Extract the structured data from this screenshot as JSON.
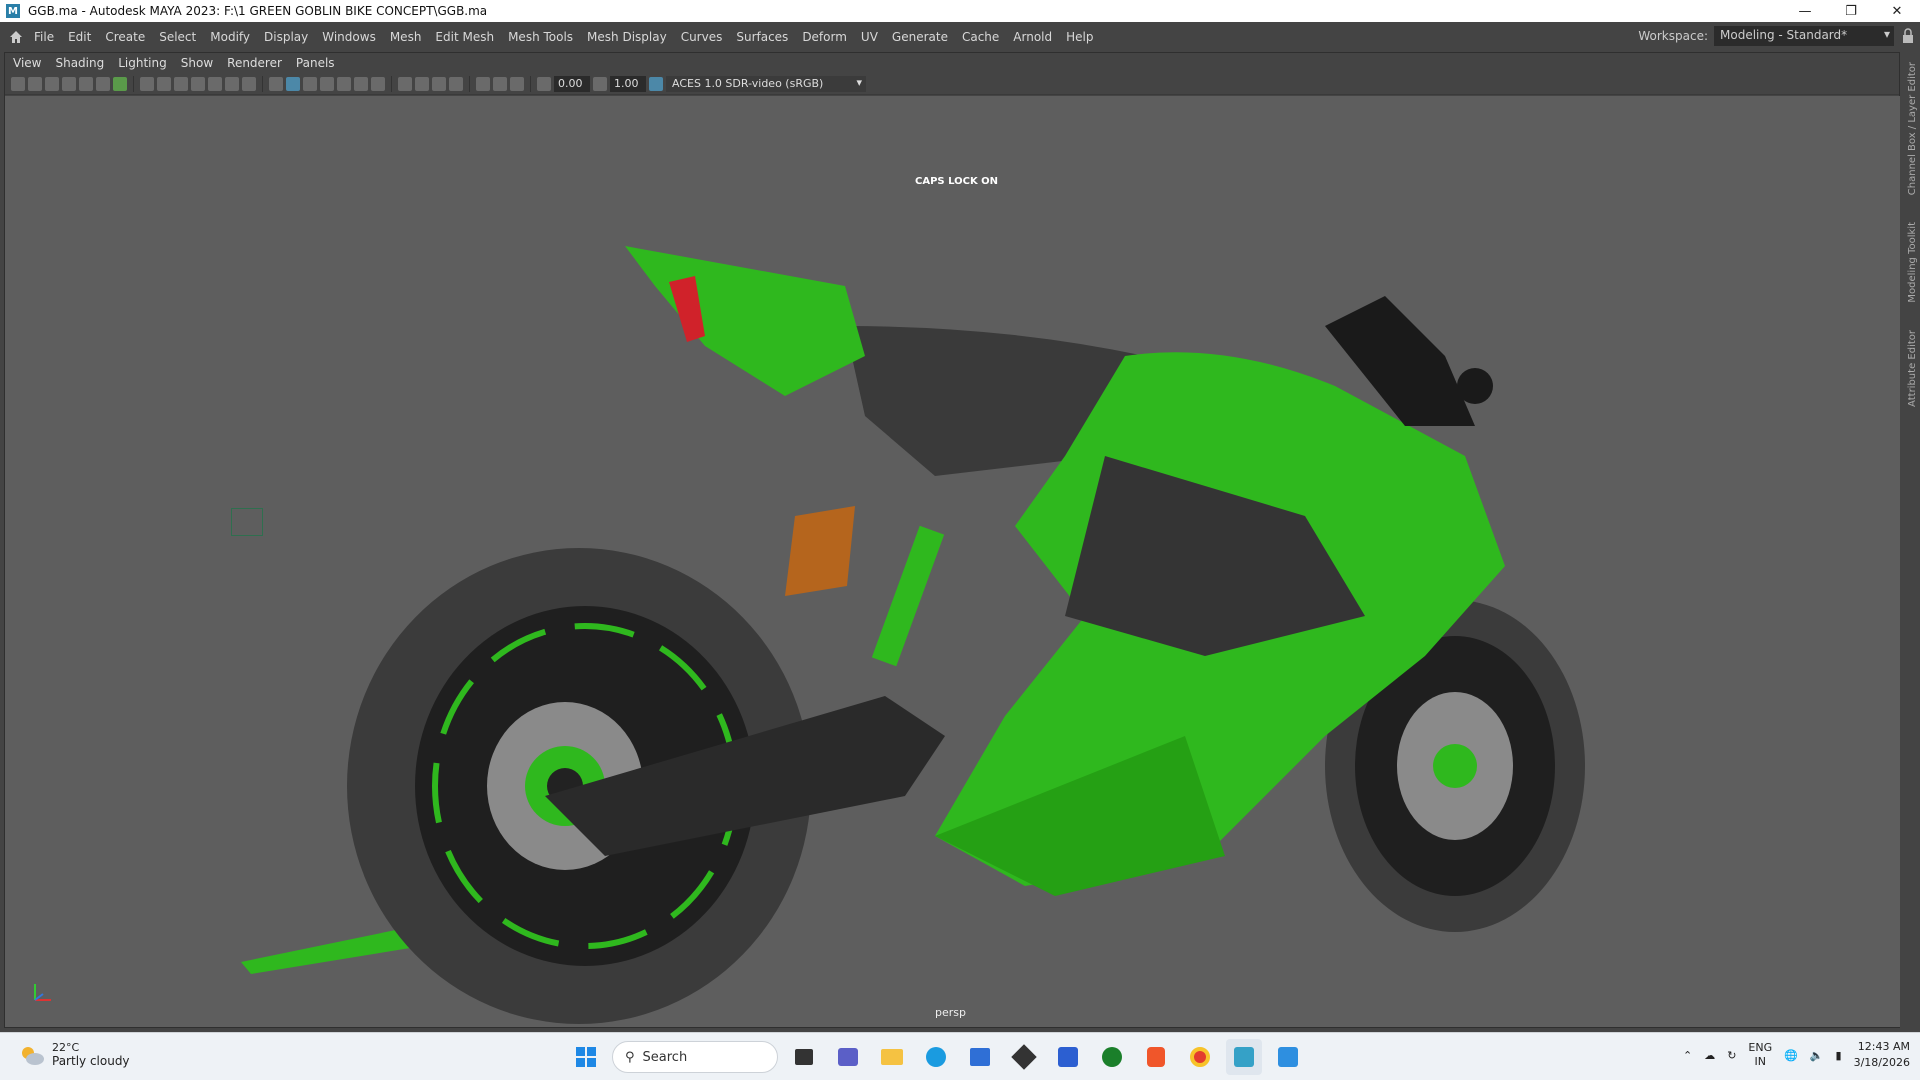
{
  "window": {
    "title": "GGB.ma - Autodesk MAYA 2023: F:\\1 GREEN GOBLIN BIKE CONCEPT\\GGB.ma",
    "app_badge": "M"
  },
  "menubar": {
    "items": [
      "File",
      "Edit",
      "Create",
      "Select",
      "Modify",
      "Display",
      "Windows",
      "Mesh",
      "Edit Mesh",
      "Mesh Tools",
      "Mesh Display",
      "Curves",
      "Surfaces",
      "Deform",
      "UV",
      "Generate",
      "Cache",
      "Arnold",
      "Help"
    ],
    "workspace_label": "Workspace:",
    "workspace_value": "Modeling - Standard*"
  },
  "panel_menu": {
    "items": [
      "View",
      "Shading",
      "Lighting",
      "Show",
      "Renderer",
      "Panels"
    ]
  },
  "toolbar": {
    "exposure": "0.00",
    "gamma": "1.00",
    "colorspace": "ACES 1.0 SDR-video (sRGB)"
  },
  "viewport": {
    "caps": "CAPS LOCK ON",
    "camera": "persp"
  },
  "side_tabs": [
    "Channel Box / Layer Editor",
    "Modeling Toolkit",
    "Attribute Editor"
  ],
  "taskbar": {
    "weather_temp": "22°C",
    "weather_desc": "Partly cloudy",
    "search_label": "Search",
    "lang_top": "ENG",
    "lang_bottom": "IN",
    "time": "12:43 AM",
    "date": "3/18/2026"
  },
  "colors": {
    "bike_green": "#2fb81e",
    "viewport_bg": "#5e5e5e",
    "maya_blue": "#4c88a8"
  }
}
